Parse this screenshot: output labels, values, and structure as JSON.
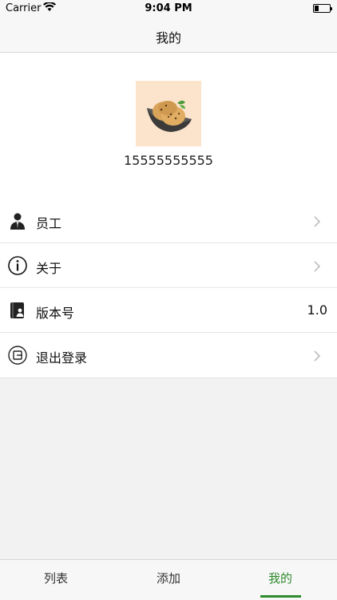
{
  "status": {
    "carrier": "Carrier",
    "time": "9:04 PM"
  },
  "header": {
    "title": "我的"
  },
  "profile": {
    "phone": "15555555555"
  },
  "menu": [
    {
      "label": "员工",
      "icon": "employee-icon"
    },
    {
      "label": "关于",
      "icon": "info-icon"
    },
    {
      "label": "版本号",
      "icon": "version-book-icon",
      "value": "1.0"
    },
    {
      "label": "退出登录",
      "icon": "logout-icon"
    }
  ],
  "tabs": [
    {
      "label": "列表"
    },
    {
      "label": "添加"
    },
    {
      "label": "我的"
    }
  ],
  "colors": {
    "accent": "#2e8b2e"
  }
}
